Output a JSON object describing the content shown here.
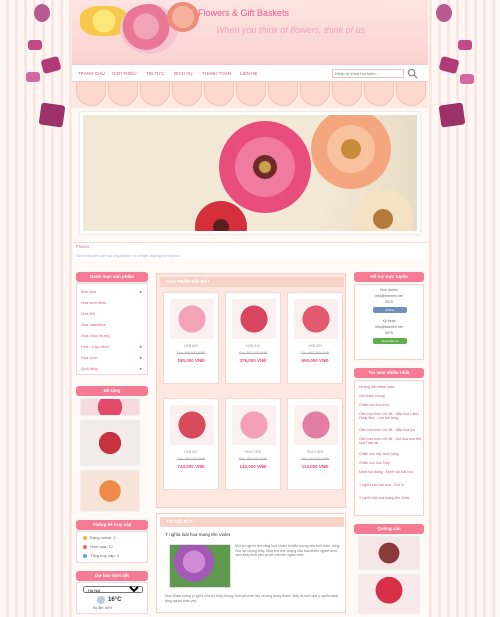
{
  "header": {
    "title": "Flowers & Gift Baskets",
    "slogan": "When you think of flowers, think of us"
  },
  "nav": {
    "items": [
      "TRANG CHỦ",
      "GIỚI THIỆU",
      "TIN TỨC",
      "DỊCH VỤ",
      "THANH TOÁN",
      "LIÊN HỆ"
    ],
    "search_placeholder": "Nhập từ khóa tìm kiếm..."
  },
  "banner": {
    "caption_title": "Flower",
    "caption_text": "Since flowers are an inspiration to create lasting memories"
  },
  "categories": {
    "title": "Danh mục sản phẩm",
    "items": [
      {
        "label": "Bán hoa",
        "arrow": "►"
      },
      {
        "label": "Hoa sinh nhật",
        "arrow": ""
      },
      {
        "label": "Hoa 8/3",
        "arrow": ""
      },
      {
        "label": "Hoa Valentine",
        "arrow": ""
      },
      {
        "label": "Hoa chúc mừng",
        "arrow": ""
      },
      {
        "label": "Hoa - Cây cảnh",
        "arrow": "►"
      },
      {
        "label": "Hoa cưới",
        "arrow": "►"
      },
      {
        "label": "Quà tặng",
        "arrow": "►"
      }
    ]
  },
  "gifts": {
    "title": "Đồ tặng"
  },
  "stats": {
    "title": "Thống kê truy cập",
    "rows": [
      "Đang online: 2",
      "Hôm qua: 12",
      "Tổng truy cập: 4"
    ]
  },
  "weather": {
    "title": "Dự báo thời tiết",
    "city": "Hà Nội",
    "temp": "16°C",
    "humidity": "Độ ẩm: 60%"
  },
  "featured": {
    "title": "SẢN PHẨM NỔI BẬT",
    "products": [
      {
        "code": "HSB 802",
        "old_price": "Giá: 190,000 VNĐ",
        "price": "180,000 VNĐ",
        "color": "#f2a4b6"
      },
      {
        "code": "HSB 812",
        "old_price": "Giá: 390,000 VNĐ",
        "price": "375,000 VNĐ",
        "color": "#d9455f"
      },
      {
        "code": "HSB 803",
        "old_price": "Giá: 680,000 VNĐ",
        "price": "650,000 VNĐ",
        "color": "#e25a6d"
      },
      {
        "code": "HSB 807",
        "old_price": "Giá: 750,000 VNĐ",
        "price": "743,000 VNĐ",
        "color": "#d94a5a"
      },
      {
        "code": "HSA 2 805",
        "old_price": "Giá: 160,000 VNĐ",
        "price": "142,000 VNĐ",
        "color": "#f3a0b8"
      },
      {
        "code": "HSA 2 803",
        "old_price": "Giá: 120,000 VNĐ",
        "price": "114,000 VNĐ",
        "color": "#e37da2"
      }
    ]
  },
  "news": {
    "title": "TIN NỔI BẬT",
    "headline": "Ý nghĩa loài hoa mang tên Violet",
    "text": "Một số người cho rằng hoa Violet là biểu tượng của tình thân, cũng như sự chung thủy. Màu tím nhẹ nhàng của hoa khiến người xem cảm thấy bình yên và dễ chịu khi ngắm nhìn.",
    "more": "Hoa Violet mang ý nghĩa của sự thủy chung, tình yêu bền lâu và lòng trung thành. Đây là món quà ý nghĩa dành tặng người thân yêu."
  },
  "support": {
    "title": "Hỗ trợ trực tuyến",
    "agents": [
      {
        "name": "Kinh doanh",
        "email": "info@tenmien.net",
        "phone": "0975",
        "status": "Online"
      },
      {
        "name": "Kỹ thuật",
        "email": "info@tenmien.net",
        "phone": "0975",
        "status": "Chat with me"
      }
    ]
  },
  "popular": {
    "title": "Tin xem nhiều nhất",
    "items": [
      "Hướng dẫn thanh toán",
      "Giới thiệu chung",
      "Chăm sóc hoa tươi",
      "Cắm hoa theo chủ đề - Mẫu hoa Cảnh Hồng Mộc - Lúa tân hồng",
      "Cắm hoa theo chủ đề - Mẫu hoa lụa",
      "Cắm hoa theo chủ đề - Giỏ hoa tươi tiết hóa Tuấn tài",
      "Chăm sóc cây cảnh hồng",
      "Chăm sóc hoa Tulip",
      "Mười hai tháng - Mười hai loài hoa",
      "Ý nghĩa các loài hoa - Chữ A",
      "Ý nghĩa loài hoa mang tên Violet"
    ]
  },
  "ads": {
    "title": "Quảng cáo"
  },
  "colors": {
    "accent": "#f57a93",
    "pink_text": "#e95c8b",
    "background_stripe": "#fbe7e2"
  }
}
